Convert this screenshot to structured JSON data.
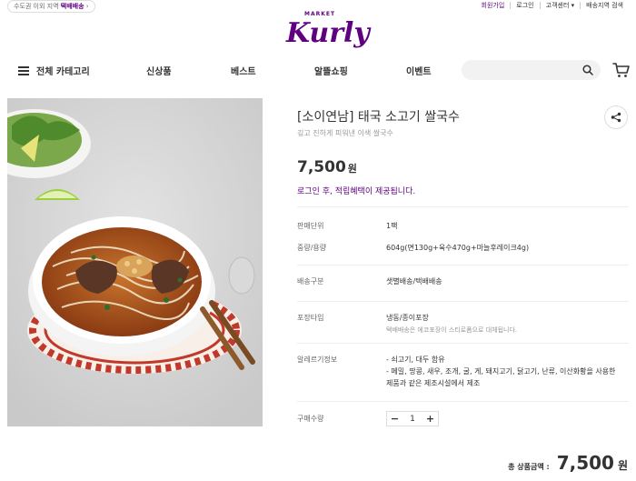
{
  "topbar": {
    "delivery_prefix": "수도권 이외 지역",
    "delivery_highlight": "택배배송",
    "delivery_arrow": "›",
    "links": [
      "회원가입",
      "로그인",
      "고객센터 ▾",
      "배송지역 검색"
    ]
  },
  "logo": {
    "market": "MARKET",
    "brand": "Kurly"
  },
  "gnb": {
    "all_category": "전체 카테고리",
    "items": [
      "신상품",
      "베스트",
      "알뜰쇼핑",
      "이벤트"
    ],
    "search_placeholder": ""
  },
  "product": {
    "title": "[소이연남] 태국 소고기 쌀국수",
    "subtitle": "깊고 진하게 피워낸 이색 쌀국수",
    "price": "7,500",
    "price_unit": "원",
    "login_benefit": "로그인 후, 적립혜택이 제공됩니다.",
    "info": [
      {
        "label": "판매단위",
        "value": "1팩"
      },
      {
        "label": "중량/용량",
        "value": "604g(면130g+육수470g+마늘후레이크4g)"
      },
      {
        "label": "배송구분",
        "value": "샛별배송/택배배송"
      },
      {
        "label": "포장타입",
        "value": "냉동/종이포장",
        "sub": "택배배송은 에코포장이 스티로폼으로 대체됩니다."
      },
      {
        "label": "알레르기정보",
        "lines": [
          "- 쇠고기, 대두 함유",
          "- 메밀, 땅콩, 새우, 조개, 굴, 게, 돼지고기, 닭고기, 난류, 이산화황을 사용한",
          "제품과 같은 제조시설에서 제조"
        ]
      },
      {
        "label": "구매수량"
      }
    ],
    "quantity": "1",
    "minus": "−",
    "plus": "+",
    "total_label": "총 상품금액 :",
    "total_amount": "7,500",
    "total_unit": "원"
  },
  "colors": {
    "brand": "#5f0080",
    "text": "#333333",
    "muted": "#999999"
  },
  "icons": [
    "hamburger-icon",
    "search-icon",
    "cart-icon",
    "share-icon"
  ]
}
